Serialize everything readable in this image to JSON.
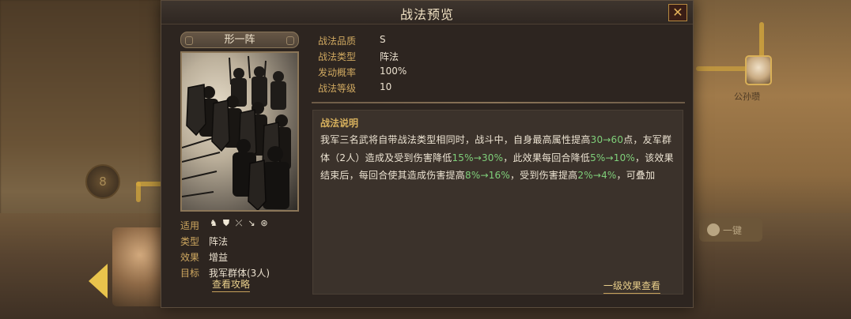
{
  "dialog": {
    "title": "战法预览",
    "close_label": "✕"
  },
  "tactic": {
    "name": "形一阵",
    "quality_label": "战法品质",
    "quality": "S",
    "type_label": "战法类型",
    "type": "阵法",
    "trigger_label": "发动概率",
    "trigger": "100%",
    "level_label": "战法等级",
    "level": "10"
  },
  "properties": {
    "usage_label": "适用",
    "usage_icons": [
      "cavalry-icon",
      "shield-icon",
      "bow-icon",
      "spear-icon",
      "vehicle-icon"
    ],
    "class_label": "类型",
    "class": "阵法",
    "effect_label": "效果",
    "effect": "增益",
    "target_label": "目标",
    "target": "我军群体(3人)",
    "strategy_link": "查看攻略"
  },
  "description": {
    "title": "战法说明",
    "segments": [
      {
        "text": "我军三名武将自带战法类型相同时，战斗中，自身最高属性提高",
        "hl": false
      },
      {
        "text": "30→60",
        "hl": true
      },
      {
        "text": "点，友军群体（2人）造成及受到伤害降低",
        "hl": false
      },
      {
        "text": "15%→30%",
        "hl": true
      },
      {
        "text": "，此效果每回合降低",
        "hl": false
      },
      {
        "text": "5%→10%",
        "hl": true
      },
      {
        "text": "，该效果结束后，每回合使其造成伤害提高",
        "hl": false
      },
      {
        "text": "8%→16%",
        "hl": true
      },
      {
        "text": "，受到伤害提高",
        "hl": false
      },
      {
        "text": "2%→4%",
        "hl": true
      },
      {
        "text": "，可叠加",
        "hl": false
      }
    ],
    "level_link": "一级效果查看"
  },
  "background": {
    "left_circle_text": "8",
    "right_name": "公孙瓒",
    "right_button": "一键"
  },
  "colors": {
    "label_gold": "#cfa860",
    "highlight_green": "#7fcf7a",
    "text_light": "#ebe1cf",
    "panel_dark": "#2d2520"
  }
}
